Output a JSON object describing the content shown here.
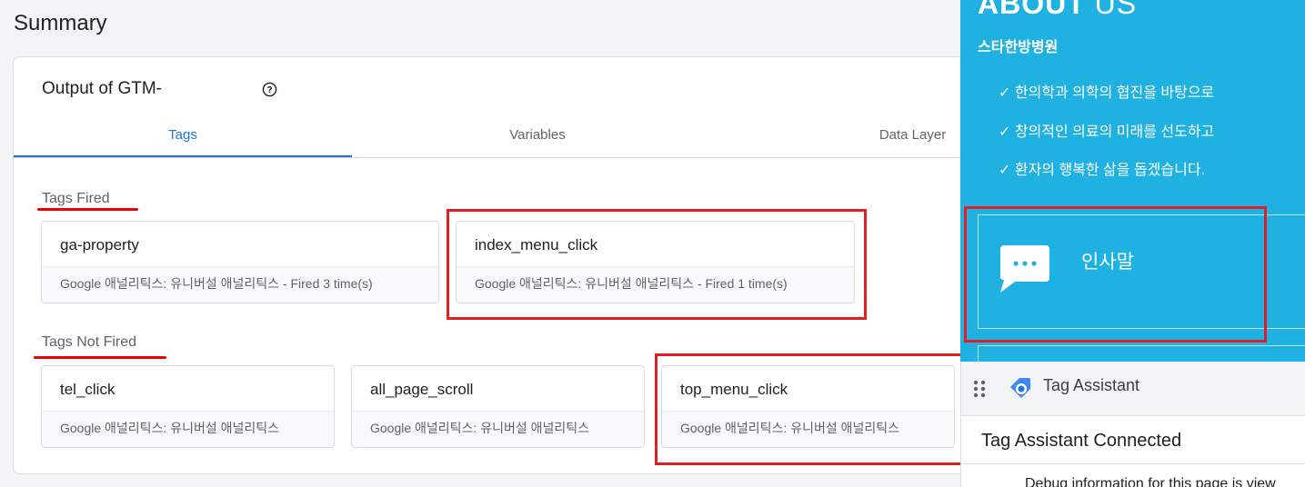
{
  "summary_title": "Summary",
  "output": {
    "title": "Output of GTM-",
    "help_icon": "help-circle-icon"
  },
  "tabs": [
    {
      "label": "Tags",
      "active": true
    },
    {
      "label": "Variables",
      "active": false
    },
    {
      "label": "Data Layer",
      "active": false
    }
  ],
  "tags_fired": {
    "heading": "Tags Fired",
    "cards": [
      {
        "name": "ga-property",
        "sub": "Google 애널리틱스: 유니버설 애널리틱스 - Fired 3 time(s)"
      },
      {
        "name": "index_menu_click",
        "sub": "Google 애널리틱스: 유니버설 애널리틱스 - Fired 1 time(s)"
      }
    ]
  },
  "tags_not_fired": {
    "heading": "Tags Not Fired",
    "cards": [
      {
        "name": "tel_click",
        "sub": "Google 애널리틱스: 유니버설 애널리틱스"
      },
      {
        "name": "all_page_scroll",
        "sub": "Google 애널리틱스: 유니버설 애널리틱스"
      },
      {
        "name": "top_menu_click",
        "sub": "Google 애널리틱스: 유니버설 애널리틱스"
      }
    ]
  },
  "site": {
    "about_bold": "ABOUT",
    "about_light": "US",
    "hospital": "스타한방병원",
    "bullets": [
      "✓ 한의학과 의학의 협진을 바탕으로",
      "✓ 창의적인 의료의 미래를 선도하고",
      "✓ 환자의 행복한 삶을 돕겠습니다."
    ],
    "greeting": "인사말",
    "chat_icon": "chat-bubble-icon"
  },
  "tag_assistant": {
    "title": "Tag Assistant",
    "status": "Tag Assistant Connected",
    "debug_text": "Debug information for this page is view"
  },
  "colors": {
    "accent_blue": "#1a73e8",
    "site_bg": "#1fb1e1",
    "highlight_red": "#e31d24"
  }
}
